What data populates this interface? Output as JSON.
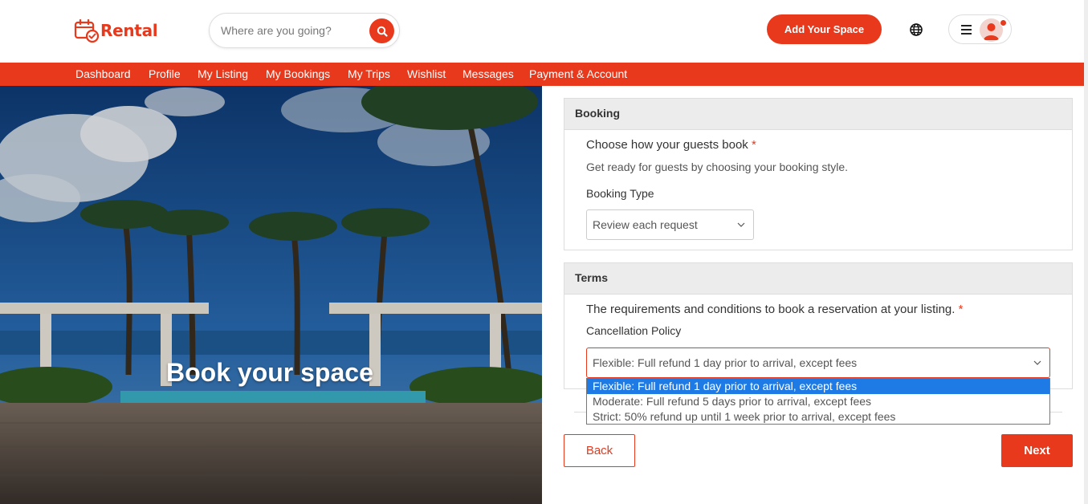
{
  "brand": {
    "name": "Rental",
    "accent": "#e8391c"
  },
  "search": {
    "placeholder": "Where are you going?",
    "icon": "search-icon"
  },
  "header": {
    "add_space_label": "Add Your Space",
    "globe_icon": "globe-icon",
    "menu_icon": "hamburger-icon",
    "avatar_icon": "user-avatar-icon"
  },
  "nav": {
    "items": [
      {
        "label": "Dashboard"
      },
      {
        "label": "Profile"
      },
      {
        "label": "My Listing"
      },
      {
        "label": "My Bookings"
      },
      {
        "label": "My Trips"
      },
      {
        "label": "Wishlist"
      },
      {
        "label": "Messages"
      },
      {
        "label": "Payment & Account"
      }
    ]
  },
  "hero": {
    "title": "Book your space"
  },
  "booking": {
    "section_title": "Booking",
    "question": "Choose how your guests book",
    "required_mark": "*",
    "subtitle": "Get ready for guests by choosing your booking style.",
    "type_label": "Booking Type",
    "type_value": "Review each request"
  },
  "terms": {
    "section_title": "Terms",
    "question": "The requirements and conditions to book a reservation at your listing.",
    "required_mark": "*",
    "policy_label": "Cancellation Policy",
    "policy_value": "Flexible: Full refund 1 day prior to arrival, except fees",
    "options": [
      {
        "label": "Flexible: Full refund 1 day prior to arrival, except fees"
      },
      {
        "label": "Moderate: Full refund 5 days prior to arrival, except fees"
      },
      {
        "label": "Strict: 50% refund up until 1 week prior to arrival, except fees"
      }
    ]
  },
  "actions": {
    "back_label": "Back",
    "next_label": "Next"
  }
}
